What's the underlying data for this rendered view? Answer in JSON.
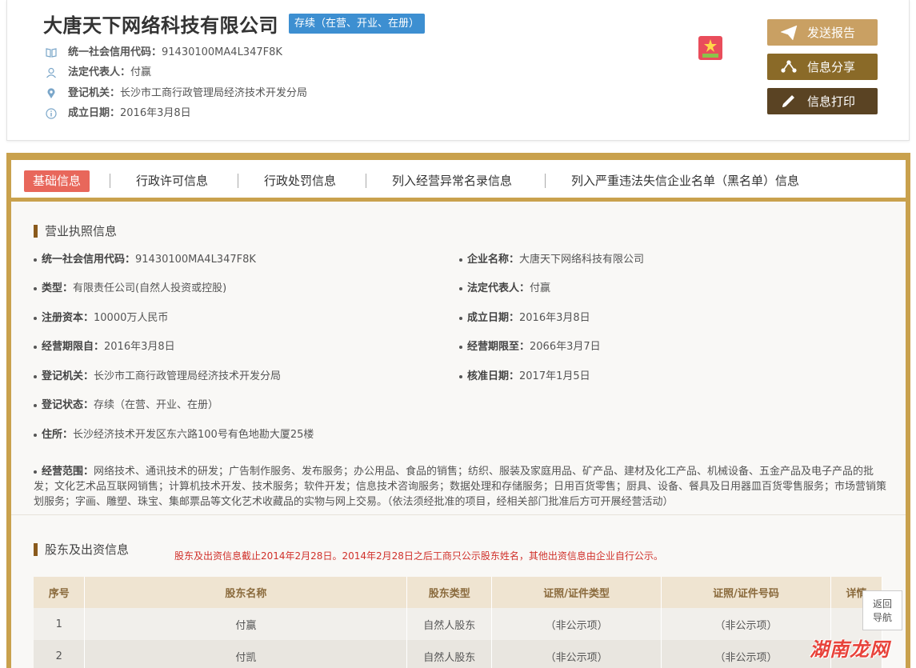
{
  "company": {
    "name": "大唐天下网络科技有限公司",
    "status_tag": "存续（在营、开业、在册）",
    "credit_code_label": "统一社会信用代码：",
    "credit_code": "91430100MA4L347F8K",
    "legal_rep_label": "法定代表人：",
    "legal_rep": "付赢",
    "reg_authority_label": "登记机关：",
    "reg_authority": "长沙市工商行政管理局经济技术开发分局",
    "found_date_label": "成立日期：",
    "found_date": "2016年3月8日"
  },
  "actions": {
    "send": "发送报告",
    "share": "信息分享",
    "print": "信息打印"
  },
  "tabs": [
    "基础信息",
    "行政许可信息",
    "行政处罚信息",
    "列入经营异常名录信息",
    "列入严重违法失信企业名单（黑名单）信息"
  ],
  "license": {
    "title": "营业执照信息",
    "fields": [
      {
        "label": "统一社会信用代码：",
        "value": "91430100MA4L347F8K"
      },
      {
        "label": "企业名称：",
        "value": "大唐天下网络科技有限公司"
      },
      {
        "label": "类型：",
        "value": "有限责任公司(自然人投资或控股)"
      },
      {
        "label": "法定代表人：",
        "value": "付赢"
      },
      {
        "label": "注册资本：",
        "value": "10000万人民币"
      },
      {
        "label": "成立日期：",
        "value": "2016年3月8日"
      },
      {
        "label": "经营期限自：",
        "value": "2016年3月8日"
      },
      {
        "label": "经营期限至：",
        "value": "2066年3月7日"
      },
      {
        "label": "登记机关：",
        "value": "长沙市工商行政管理局经济技术开发分局"
      },
      {
        "label": "核准日期：",
        "value": "2017年1月5日"
      },
      {
        "label": "登记状态：",
        "value": "存续（在营、开业、在册）"
      },
      {
        "label": "住所：",
        "value": "长沙经济技术开发区东六路100号有色地勘大厦25楼"
      }
    ],
    "scope_label": "经营范围：",
    "scope": "网络技术、通讯技术的研发；广告制作服务、发布服务；办公用品、食品的销售；纺织、服装及家庭用品、矿产品、建材及化工产品、机械设备、五金产品及电子产品的批发；文化艺术品互联网销售；计算机技术开发、技术服务；软件开发；信息技术咨询服务；数据处理和存储服务；日用百货零售；厨具、设备、餐具及日用器皿百货零售服务；市场营销策划服务；字画、雕塑、珠宝、集邮票品等文化艺术收藏品的实物与网上交易。（依法须经批准的项目，经相关部门批准后方可开展经营活动）"
  },
  "shareholders": {
    "title": "股东及出资信息",
    "notice": "股东及出资信息截止2014年2月28日。2014年2月28日之后工商只公示股东姓名，其他出资信息由企业自行公示。",
    "columns": [
      "序号",
      "股东名称",
      "股东类型",
      "证照/证件类型",
      "证照/证件号码",
      "详情"
    ],
    "rows": [
      [
        "1",
        "付赢",
        "自然人股东",
        "（非公示项）",
        "（非公示项）",
        ""
      ],
      [
        "2",
        "付凯",
        "自然人股东",
        "（非公示项）",
        "（非公示项）",
        ""
      ]
    ]
  },
  "back_nav": {
    "line1": "返回",
    "line2": "导航"
  },
  "watermark": "湖南龙网",
  "colors": {
    "gold": "#c9a14d",
    "tab_active": "#e8675b",
    "status_tag": "#3d8fd1",
    "notice": "#d0302a"
  }
}
